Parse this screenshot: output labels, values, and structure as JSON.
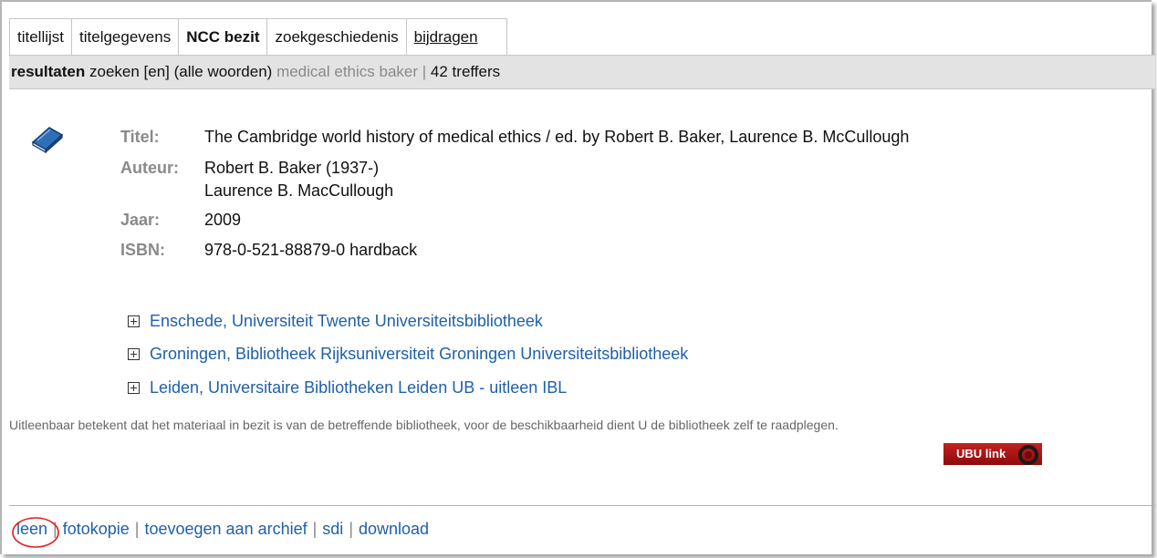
{
  "tabs": [
    {
      "label": "titellijst"
    },
    {
      "label": "titelgegevens"
    },
    {
      "label": "NCC bezit"
    },
    {
      "label": "zoekgeschiedenis"
    },
    {
      "label": "bijdragen"
    }
  ],
  "results": {
    "label": "resultaten",
    "search_text": "zoeken [en] (alle woorden)",
    "query": "medical ethics baker",
    "separator": "|",
    "hits": "42 treffers"
  },
  "record": {
    "icon": "book-icon",
    "title_label": "Titel:",
    "title_value": "The Cambridge world history of medical ethics / ed. by Robert B. Baker, Laurence B. McCullough",
    "author_label": "Auteur:",
    "authors": [
      "Robert B. Baker (1937-)",
      "Laurence B. MacCullough"
    ],
    "year_label": "Jaar:",
    "year_value": "2009",
    "isbn_label": "ISBN:",
    "isbn_value": "978-0-521-88879-0 hardback"
  },
  "libraries": [
    {
      "label": "Enschede, Universiteit Twente Universiteitsbibliotheek"
    },
    {
      "label": "Groningen, Bibliotheek Rijksuniversiteit Groningen Universiteitsbibliotheek"
    },
    {
      "label": "Leiden, Universitaire Bibliotheken Leiden UB - uitleen IBL"
    }
  ],
  "notice": "Uitleenbaar betekent dat het materiaal in bezit is van de betreffende bibliotheek, voor de beschikbaarheid dient U de bibliotheek zelf te raadplegen.",
  "ubu_link": {
    "label": "UBU link"
  },
  "actions": [
    {
      "label": "leen"
    },
    {
      "label": "fotokopie"
    },
    {
      "label": "toevoegen aan archief"
    },
    {
      "label": "sdi"
    },
    {
      "label": "download"
    }
  ],
  "action_separator": "|",
  "colors": {
    "link": "#2060a8",
    "bar_bg": "#e3e3e3",
    "label_gray": "#8a8a8a",
    "ubu_red": "#b01515",
    "highlight_circle": "#e02020"
  }
}
